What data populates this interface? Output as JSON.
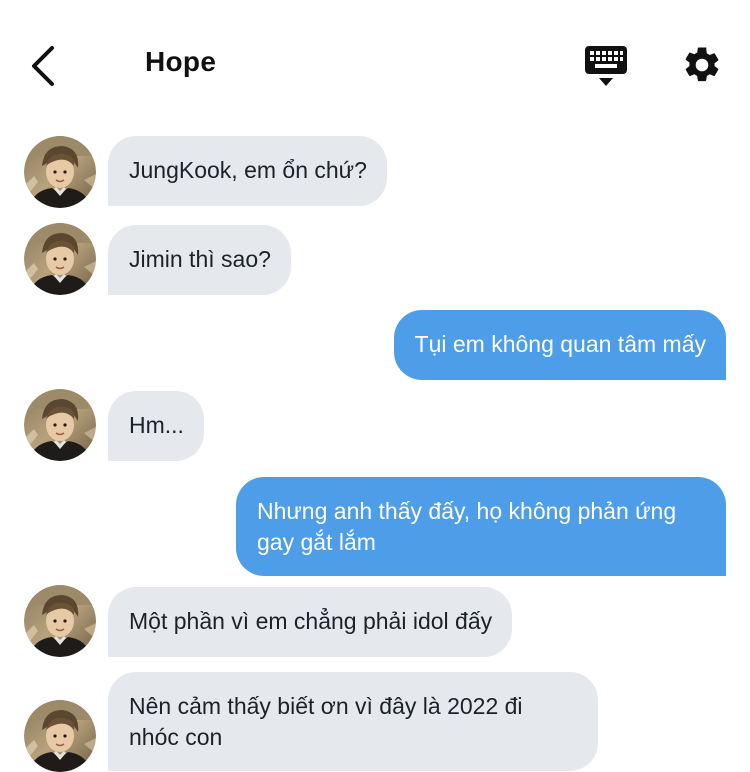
{
  "header": {
    "title": "Hope",
    "back_icon": "chevron-left-icon",
    "keyboard_icon": "keyboard-icon",
    "settings_icon": "gear-icon"
  },
  "colors": {
    "incoming_bubble": "#e5e9ee",
    "outgoing_bubble": "#4d9de8",
    "incoming_text": "#1d2227",
    "outgoing_text": "#ffffff"
  },
  "messages": [
    {
      "from": "Hope",
      "text": "JungKook, em ổn chứ?"
    },
    {
      "from": "Hope",
      "text": "Jimin thì sao?"
    },
    {
      "from": "me",
      "text": "Tụi em không quan tâm mấy"
    },
    {
      "from": "Hope",
      "text": "Hm..."
    },
    {
      "from": "me",
      "text": "Nhưng anh thấy đấy, họ không phản ứng gay gắt lắm"
    },
    {
      "from": "Hope",
      "text": "Một phần vì em chẳng phải idol đấy"
    },
    {
      "from": "Hope",
      "text": "Nên cảm thấy biết ơn vì đây là 2022 đi nhóc con"
    }
  ]
}
